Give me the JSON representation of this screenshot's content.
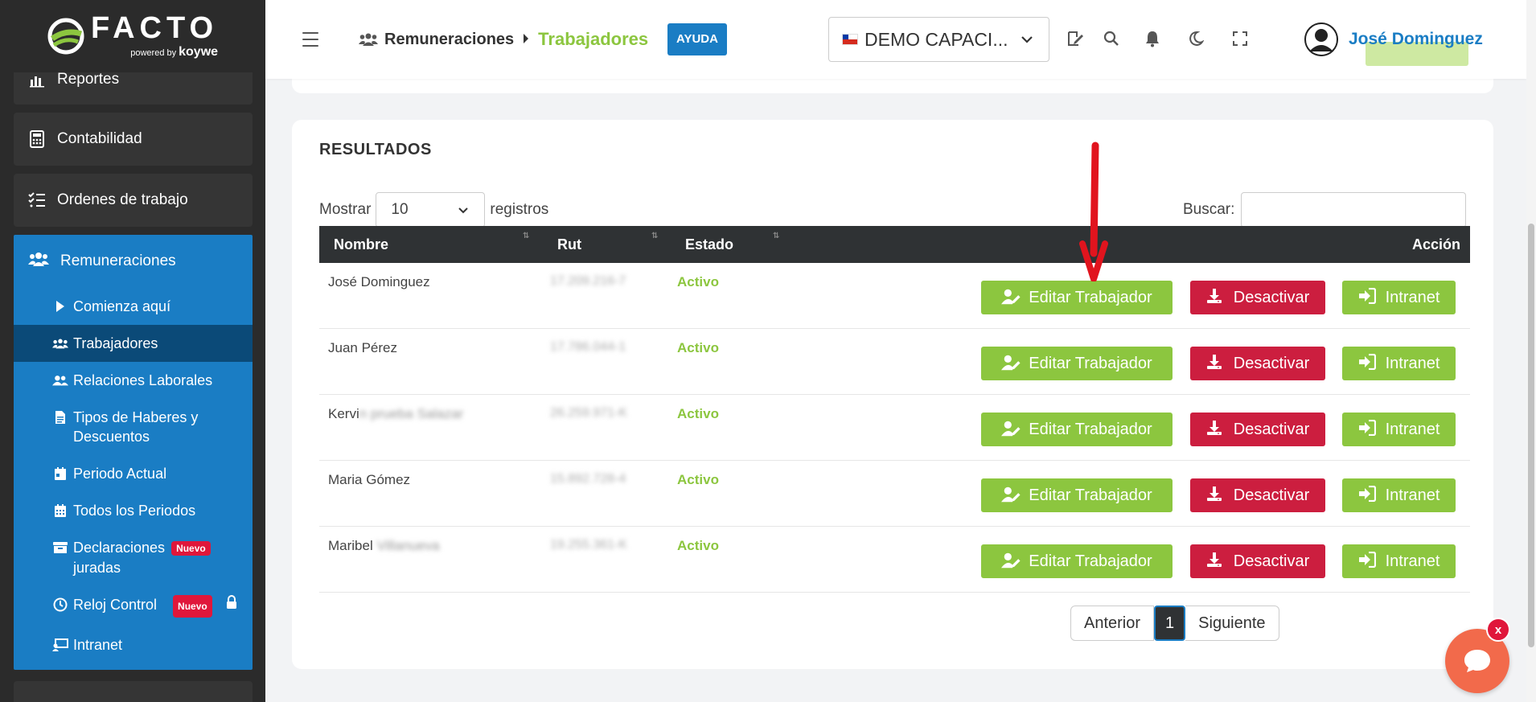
{
  "app": {
    "logo_text": "FACTO",
    "logo_powered": "powered by",
    "logo_brand": "koywe"
  },
  "sidebar": {
    "items": [
      {
        "label": "Reportes",
        "icon": "chart-icon"
      },
      {
        "label": "Contabilidad",
        "icon": "calculator-icon"
      },
      {
        "label": "Ordenes de trabajo",
        "icon": "tasks-icon"
      }
    ],
    "group": {
      "label": "Remuneraciones",
      "icon": "users-icon",
      "items": [
        {
          "label": "Comienza aquí",
          "icon": "play-icon"
        },
        {
          "label": "Trabajadores",
          "icon": "users-icon",
          "active": true
        },
        {
          "label": "Relaciones Laborales",
          "icon": "user-group-icon"
        },
        {
          "label": "Tipos de Haberes y Descuentos",
          "icon": "file-icon"
        },
        {
          "label": "Periodo Actual",
          "icon": "calendar-day-icon"
        },
        {
          "label": "Todos los Periodos",
          "icon": "calendar-icon"
        },
        {
          "label": "Declaraciones juradas",
          "icon": "archive-icon",
          "badge": "Nuevo"
        },
        {
          "label": "Reloj Control",
          "icon": "clock-icon",
          "badge": "Nuevo",
          "locked": true
        },
        {
          "label": "Intranet",
          "icon": "chalkboard-icon"
        }
      ]
    }
  },
  "header": {
    "breadcrumb_parent": "Remuneraciones",
    "breadcrumb_current": "Trabajadores",
    "help_label": "AYUDA",
    "company": "DEMO CAPACI...",
    "user_name": "José Dominguez"
  },
  "results": {
    "title": "RESULTADOS",
    "show_label": "Mostrar",
    "show_value": "10",
    "records_label": "registros",
    "search_label": "Buscar:",
    "search_value": "",
    "columns": {
      "name": "Nombre",
      "rut": "Rut",
      "status": "Estado",
      "action": "Acción"
    },
    "rows": [
      {
        "name": "José Dominguez",
        "name_hidden": "",
        "rut": "17.209.216-7",
        "status": "Activo"
      },
      {
        "name": "Juan Pérez",
        "name_hidden": "",
        "rut": "17.786.044-1",
        "status": "Activo"
      },
      {
        "name": "Kervi",
        "name_hidden": "n prueba Salazar",
        "rut": "26.259.971-K",
        "status": "Activo"
      },
      {
        "name": "Maria Gómez",
        "name_hidden": "",
        "rut": "15.892.728-4",
        "status": "Activo"
      },
      {
        "name": "Maribel",
        "name_hidden": " Villanueva",
        "rut": "19.255.361-K",
        "status": "Activo"
      }
    ],
    "actions": {
      "edit": "Editar Trabajador",
      "deactivate": "Desactivar",
      "intranet": "Intranet"
    },
    "pager": {
      "prev": "Anterior",
      "current": "1",
      "next": "Siguiente"
    }
  },
  "chat": {
    "close": "x"
  },
  "colors": {
    "green": "#8cc63f",
    "blue": "#1a7dc4",
    "red": "#cc1e3f",
    "dark": "#2f3234"
  }
}
